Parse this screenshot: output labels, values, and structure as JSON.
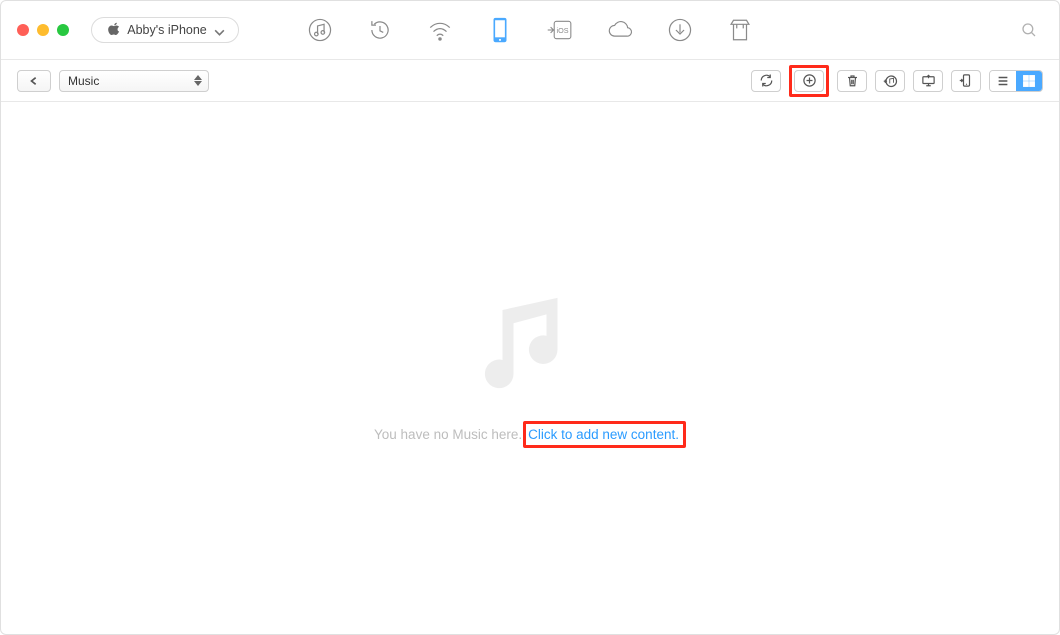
{
  "device": {
    "name": "Abby's iPhone"
  },
  "category": {
    "selected": "Music"
  },
  "empty": {
    "message": "You have no Music here.",
    "link": "Click to add new content."
  }
}
